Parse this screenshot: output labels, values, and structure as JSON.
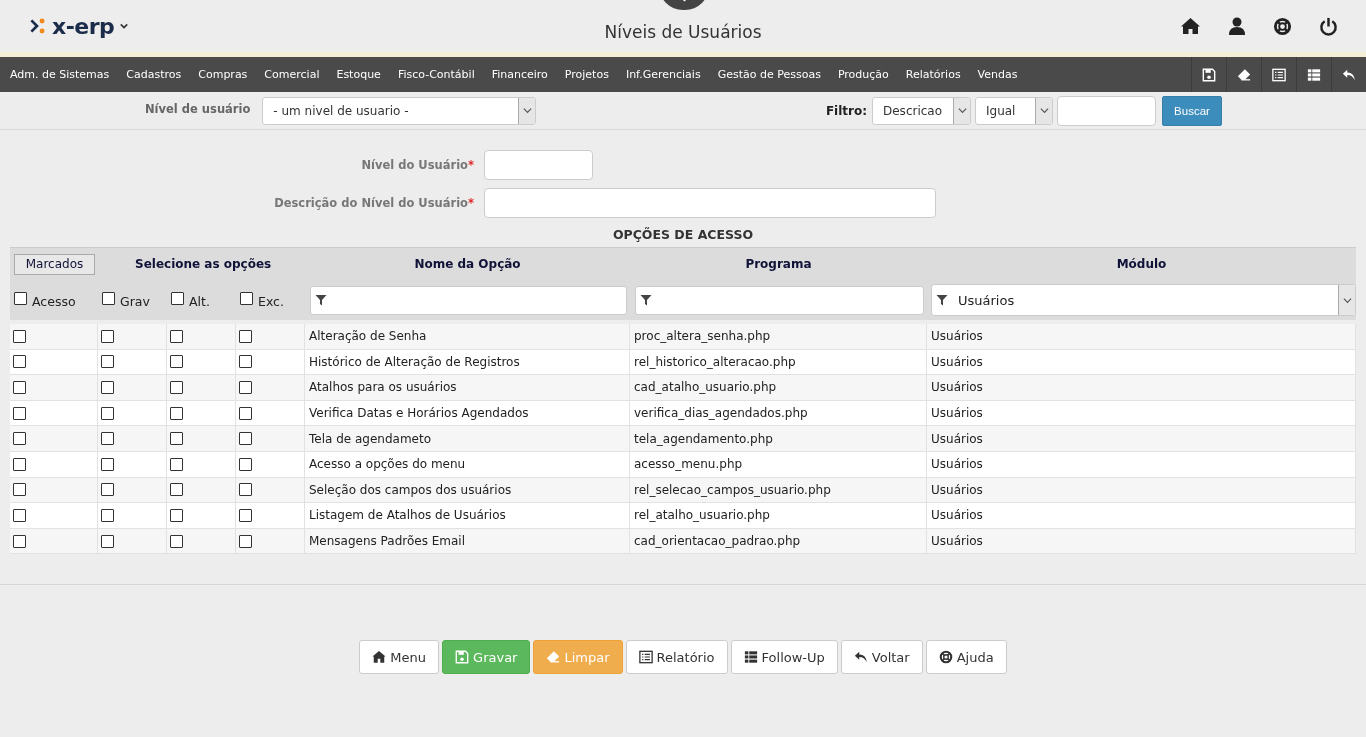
{
  "header": {
    "logo": "x-erp",
    "title": "Níveis de Usuários"
  },
  "menu": [
    "Adm. de Sistemas",
    "Cadastros",
    "Compras",
    "Comercial",
    "Estoque",
    "Fisco-Contábil",
    "Financeiro",
    "Projetos",
    "Inf.Gerenciais",
    "Gestão de Pessoas",
    "Produção",
    "Relatórios",
    "Vendas"
  ],
  "filter_bar": {
    "level_label": "Nível de usuário",
    "level_value": "- um nivel de usuario -",
    "filter_label": "Filtro:",
    "field_value": "Descricao",
    "operator_value": "Igual",
    "search_button": "Buscar"
  },
  "form": {
    "level_label": "Nível do Usuário",
    "level_required": "*",
    "description_label": "Descrição do Nível do Usuário",
    "description_required": "*"
  },
  "section_title": "OPÇÕES DE ACESSO",
  "table": {
    "marked_button": "Marcados",
    "select_heading": "Selecione as opções",
    "columns": [
      "Nome da Opção",
      "Programa",
      "Módulo"
    ],
    "check_headers": [
      {
        "label": "Acesso",
        "checked": false
      },
      {
        "label": "Grav",
        "checked": false
      },
      {
        "label": "Alt.",
        "checked": false
      },
      {
        "label": "Exc.",
        "checked": false
      }
    ],
    "module_filter": "Usuários",
    "rows": [
      {
        "checks": [
          false,
          false,
          false,
          false
        ],
        "name": "Alteração de Senha",
        "program": "proc_altera_senha.php",
        "module": "Usuários"
      },
      {
        "checks": [
          false,
          false,
          false,
          false
        ],
        "name": "Histórico de Alteração de Registros",
        "program": "rel_historico_alteracao.php",
        "module": "Usuários"
      },
      {
        "checks": [
          false,
          false,
          false,
          false
        ],
        "name": "Atalhos para os usuários",
        "program": "cad_atalho_usuario.php",
        "module": "Usuários"
      },
      {
        "checks": [
          false,
          false,
          false,
          false
        ],
        "name": "Verifica Datas e Horários Agendados",
        "program": "verifica_dias_agendados.php",
        "module": "Usuários"
      },
      {
        "checks": [
          false,
          false,
          false,
          false
        ],
        "name": "Tela de agendameto",
        "program": "tela_agendamento.php",
        "module": "Usuários"
      },
      {
        "checks": [
          false,
          false,
          false,
          false
        ],
        "name": "Acesso a opções do menu",
        "program": "acesso_menu.php",
        "module": "Usuários"
      },
      {
        "checks": [
          false,
          false,
          false,
          false
        ],
        "name": "Seleção dos campos dos usuários",
        "program": "rel_selecao_campos_usuario.php",
        "module": "Usuários"
      },
      {
        "checks": [
          false,
          false,
          false,
          false
        ],
        "name": "Listagem de Atalhos de Usuários",
        "program": "rel_atalho_usuario.php",
        "module": "Usuários"
      },
      {
        "checks": [
          false,
          false,
          false,
          false
        ],
        "name": "Mensagens Padrões Email",
        "program": "cad_orientacao_padrao.php",
        "module": "Usuários"
      }
    ]
  },
  "buttons": [
    {
      "label": "Menu",
      "kind": "default"
    },
    {
      "label": "Gravar",
      "kind": "success"
    },
    {
      "label": "Limpar",
      "kind": "warning"
    },
    {
      "label": "Relatório",
      "kind": "default"
    },
    {
      "label": "Follow-Up",
      "kind": "default"
    },
    {
      "label": "Voltar",
      "kind": "default"
    },
    {
      "label": "Ajuda",
      "kind": "default"
    }
  ]
}
